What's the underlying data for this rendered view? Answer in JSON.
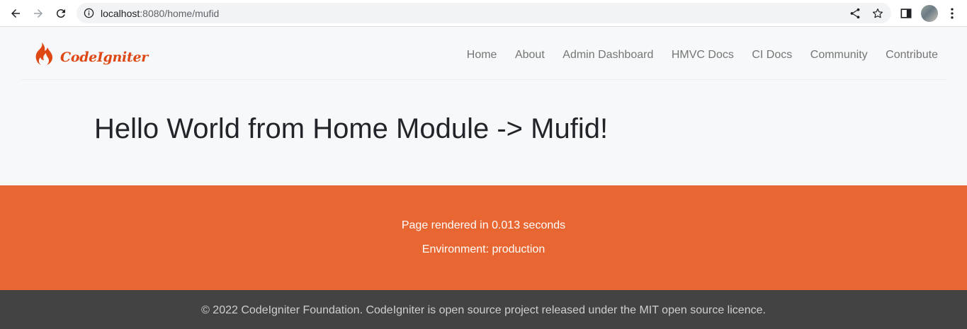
{
  "browser": {
    "url_host": "localhost",
    "url_rest": ":8080/home/mufid",
    "icons": {
      "back": "arrow-left-icon",
      "forward": "arrow-right-icon",
      "reload": "reload-icon",
      "info": "info-icon",
      "share": "share-icon",
      "bookmark": "star-icon",
      "side_panel": "side-panel-icon",
      "profile": "avatar",
      "menu": "kebab-menu-icon"
    }
  },
  "header": {
    "brand_name": "CodeIgniter",
    "nav": [
      {
        "label": "Home"
      },
      {
        "label": "About"
      },
      {
        "label": "Admin Dashboard"
      },
      {
        "label": "HMVC Docs"
      },
      {
        "label": "CI Docs"
      },
      {
        "label": "Community"
      },
      {
        "label": "Contribute"
      }
    ]
  },
  "main": {
    "heading": "Hello World from Home Module -> Mufid!"
  },
  "footer": {
    "render_time": "Page rendered in 0.013 seconds",
    "environment": "Environment: production"
  },
  "copyright": {
    "text": "© 2022 CodeIgniter Foundation. CodeIgniter is open source project released under the MIT open source licence."
  },
  "colors": {
    "brand": "#dd4814",
    "footer_orange": "#e86631",
    "copyright_bg": "#434343"
  }
}
